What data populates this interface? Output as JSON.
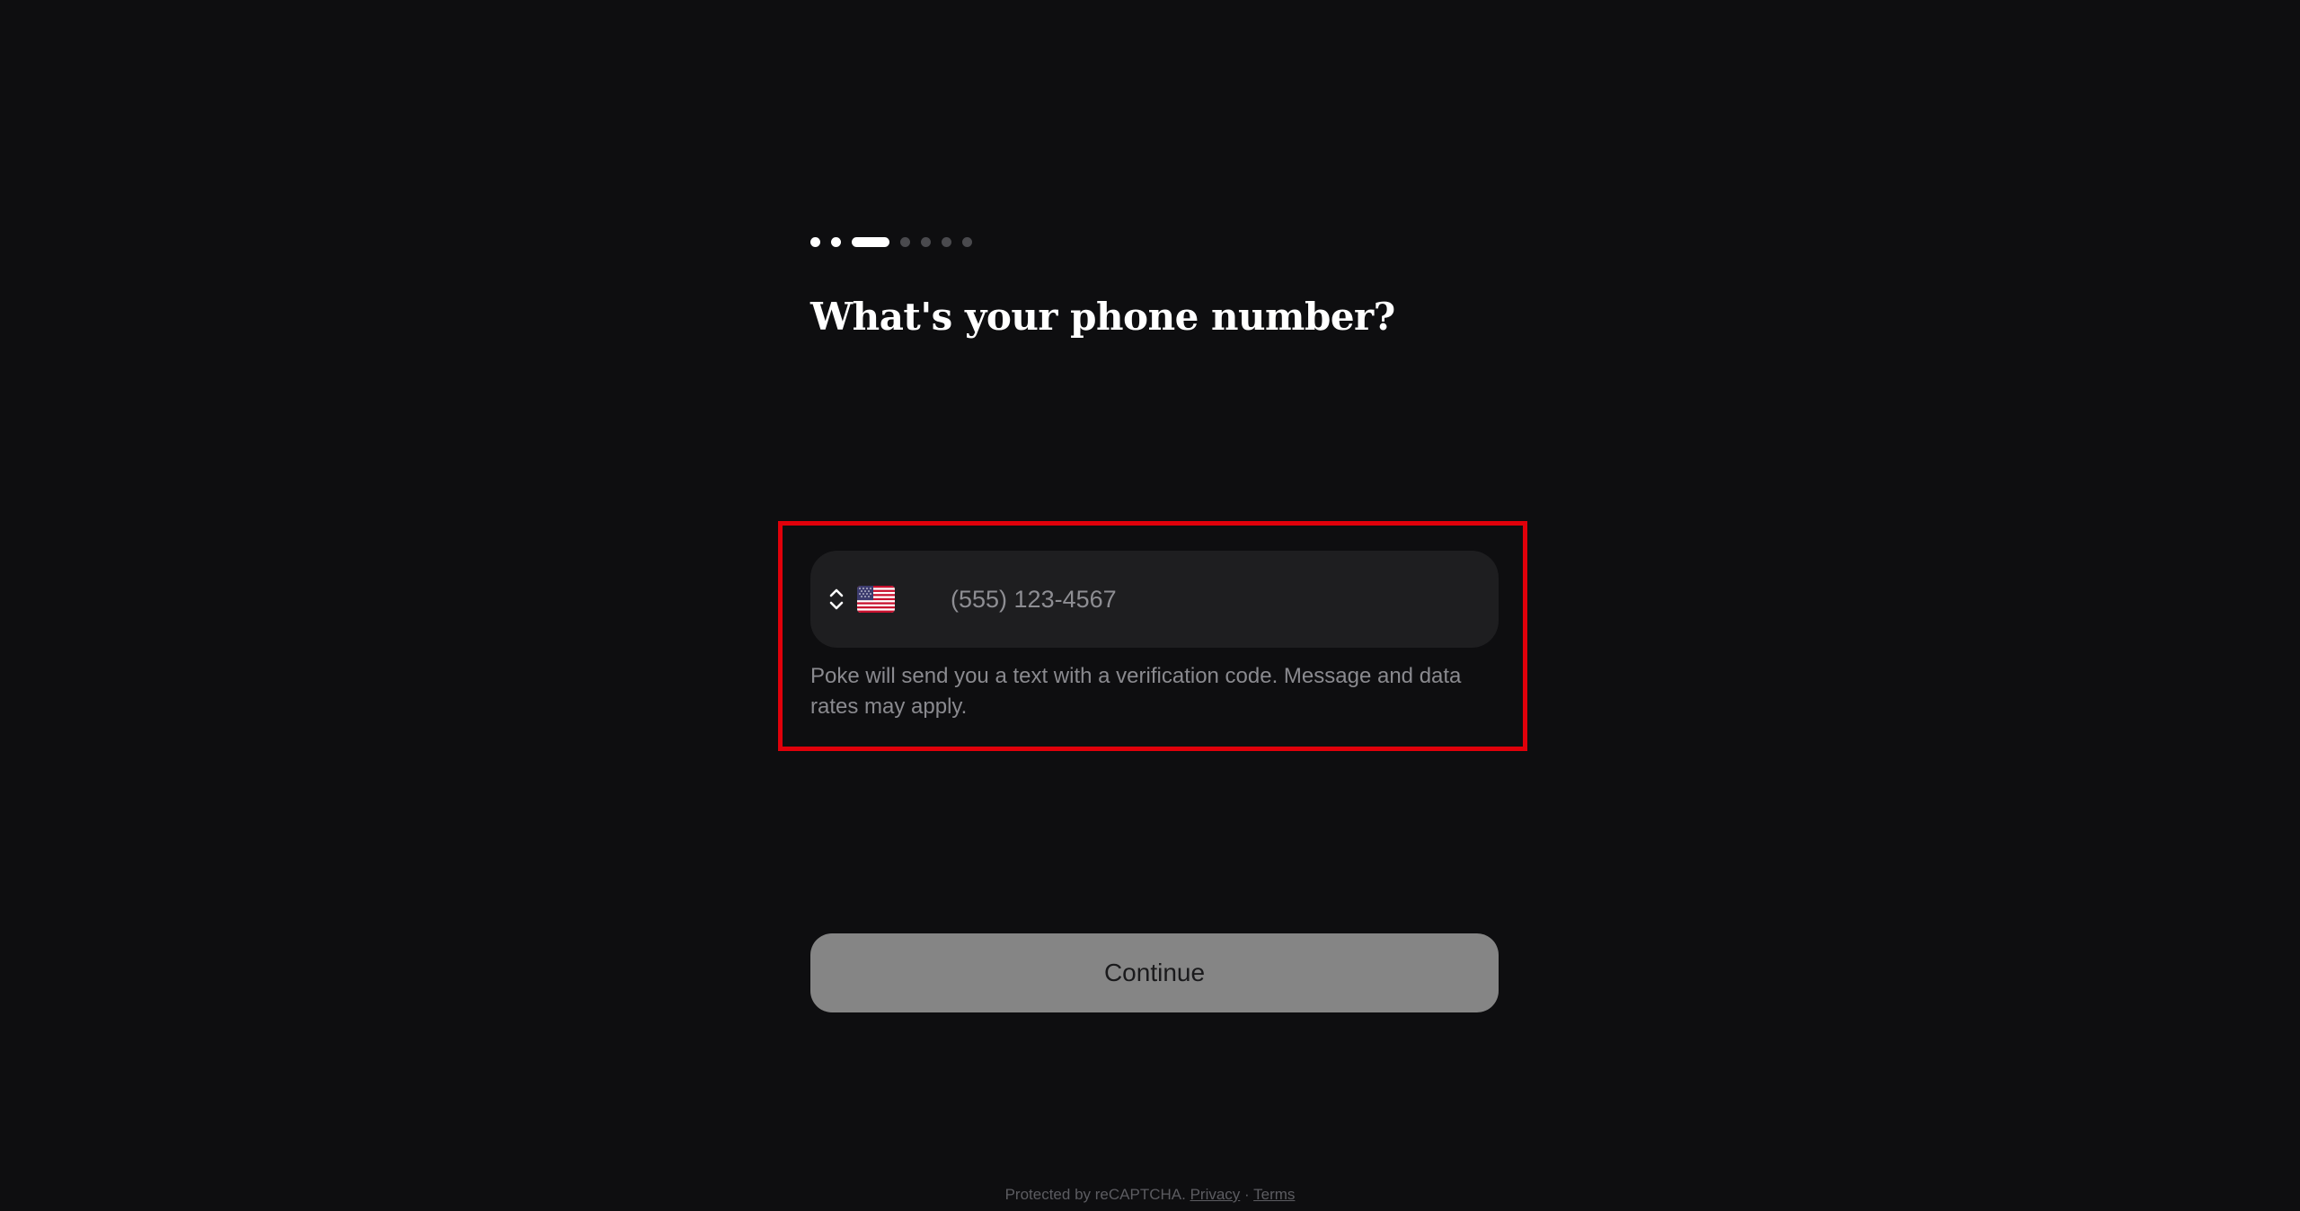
{
  "progress": {
    "steps": [
      "done",
      "done",
      "current",
      "todo",
      "todo",
      "todo",
      "todo"
    ]
  },
  "form": {
    "title": "What's your phone number?",
    "country": {
      "selected_flag_icon": "us-flag-icon",
      "chevron_icon": "up-down-chevron-icon"
    },
    "phone": {
      "value": "",
      "placeholder": "(555) 123-4567"
    },
    "disclaimer": "Poke will send you a text with a verification code. Message and data rates may apply.",
    "continue_label": "Continue"
  },
  "footer": {
    "protected_text": "Protected by reCAPTCHA.",
    "privacy_label": "Privacy",
    "separator": "·",
    "terms_label": "Terms"
  },
  "colors": {
    "background": "#0e0e10",
    "field_bg": "#1e1e20",
    "highlight": "#e0000a",
    "button_bg": "#858585"
  }
}
